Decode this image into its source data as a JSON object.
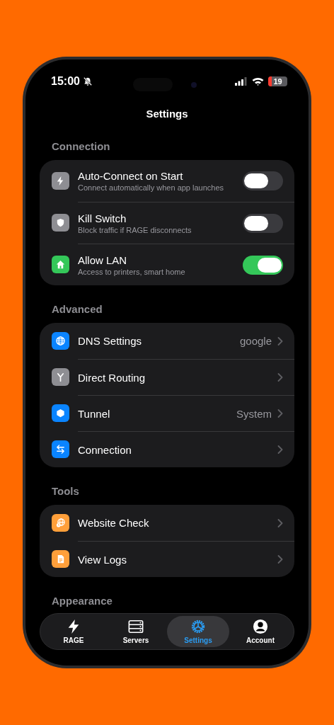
{
  "status_bar": {
    "time": "15:00",
    "battery": "19"
  },
  "title": "Settings",
  "sections": [
    {
      "header": "Connection",
      "items": [
        {
          "kind": "toggle",
          "title": "Auto-Connect on Start",
          "subtitle": "Connect automatically when app launches",
          "on": false,
          "color": "#8e8e93"
        },
        {
          "kind": "toggle",
          "title": "Kill Switch",
          "subtitle": "Block traffic if RAGE disconnects",
          "on": false,
          "color": "#8e8e93"
        },
        {
          "kind": "toggle",
          "title": "Allow LAN",
          "subtitle": "Access to printers, smart home",
          "on": true,
          "color": "#34c759"
        }
      ]
    },
    {
      "header": "Advanced",
      "items": [
        {
          "kind": "link",
          "title": "DNS Settings",
          "value": "google",
          "color": "#0a84ff"
        },
        {
          "kind": "link",
          "title": "Direct Routing",
          "color": "#8e8e93"
        },
        {
          "kind": "link",
          "title": "Tunnel",
          "value": "System",
          "color": "#0a84ff"
        },
        {
          "kind": "link",
          "title": "Connection",
          "color": "#0a84ff"
        }
      ]
    },
    {
      "header": "Tools",
      "items": [
        {
          "kind": "link",
          "title": "Website Check",
          "color": "#ff9f3a"
        },
        {
          "kind": "link",
          "title": "View Logs",
          "color": "#ff9f3a"
        }
      ]
    },
    {
      "header": "Appearance"
    }
  ],
  "tabs": [
    {
      "label": "RAGE",
      "selected": false
    },
    {
      "label": "Servers",
      "selected": false
    },
    {
      "label": "Settings",
      "selected": true
    },
    {
      "label": "Account",
      "selected": false
    }
  ]
}
